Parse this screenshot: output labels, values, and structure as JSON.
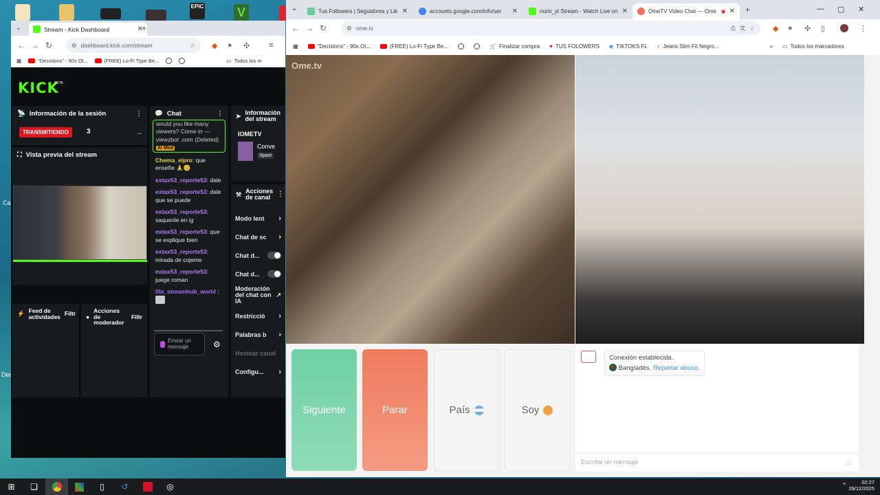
{
  "desktop": {
    "labels": [
      "Ca",
      "Dec"
    ]
  },
  "left_browser": {
    "tab_title": "Stream - Kick Dashboard",
    "url": "dashboard.kick.com/stream",
    "bookmarks": [
      "\"Decisions\" - 90s Ol...",
      "(FREE) Lo-Fi Type Be...",
      "Todos los m"
    ]
  },
  "kick": {
    "logo": "KICK",
    "beta": "BETA",
    "session_title": "Información de la sesión",
    "live_badge": "TRANSMITIENDO",
    "viewers": "3",
    "preview_title": "Vista previa del stream",
    "activity_feed": "Feed de actividades",
    "filter": "Filtr",
    "mod_actions": "Acciones de moderador",
    "filter2": "Filtr",
    "chat_title": "Chat",
    "chat_messages": [
      {
        "user": "",
        "text": "would you like many viewers? Come in — viewzbot .com (Deleted)",
        "badge": "AI Mod"
      },
      {
        "user": "Chema_elpro",
        "text": "que enseñe 🙏😊"
      },
      {
        "user": "extax53_reporte53",
        "text": "dale"
      },
      {
        "user": "extax53_reporte53",
        "text": "dale que se puede"
      },
      {
        "user": "extax53_reporte53",
        "text": "saquenle en ig"
      },
      {
        "user": "extax53_reporte53",
        "text": "que se explique bien"
      },
      {
        "user": "extax53_reporte53",
        "text": "mirada de cojeme"
      },
      {
        "user": "extax53_reporte53",
        "text": "juege roman"
      },
      {
        "user": "0bi_streamhub_world",
        "text": ""
      }
    ],
    "chat_placeholder": "Enviar un mensaje",
    "stream_info_title": "Información del stream",
    "stream_channel": "IOMETV",
    "stream_cat1": "Conve",
    "stream_cat2": "Spani",
    "channel_actions_title": "Acciones de canal",
    "actions": [
      {
        "label": "Modo lent",
        "type": "chevron"
      },
      {
        "label": "Chat de sc",
        "type": "chevron"
      },
      {
        "label": "Chat d...",
        "type": "toggle"
      },
      {
        "label": "Chat d...",
        "type": "toggle"
      },
      {
        "label": "Moderación del chat con IA",
        "type": "external"
      },
      {
        "label": "Restricció",
        "type": "chevron"
      },
      {
        "label": "Palabras b",
        "type": "chevron"
      },
      {
        "label": "Hostear canal",
        "type": "disabled"
      },
      {
        "label": "Configu...",
        "type": "chevron"
      }
    ]
  },
  "right_browser": {
    "tabs": [
      {
        "title": "Tus Followers | Seguidores y Lik"
      },
      {
        "title": "accounts.google.com/info/ser"
      },
      {
        "title": "numi_yt Stream - Watch Live on"
      },
      {
        "title": "OmeTV Video Chat — Ome"
      }
    ],
    "url": "ome.tv",
    "bookmarks": [
      "\"Decisions\" - 90s Ol...",
      "(FREE) Lo-Fi Type Be...",
      "Finalizar compra",
      "TUS FOLOWERS",
      "TIKTOKS FL",
      "Jeans Slim Fit Negro...",
      "Todos los marcadores"
    ]
  },
  "ome": {
    "logo": "Ome.tv",
    "btn_next": "Siguiente",
    "btn_stop": "Parar",
    "btn_country": "País",
    "btn_me": "Soy",
    "system_msg": "Conexión establecida.",
    "country": "Bangladés.",
    "report": "Reportar abuso.",
    "input_placeholder": "Escribe un mensaje"
  },
  "taskbar": {
    "time": "02:27",
    "date": "29/12/2025"
  }
}
